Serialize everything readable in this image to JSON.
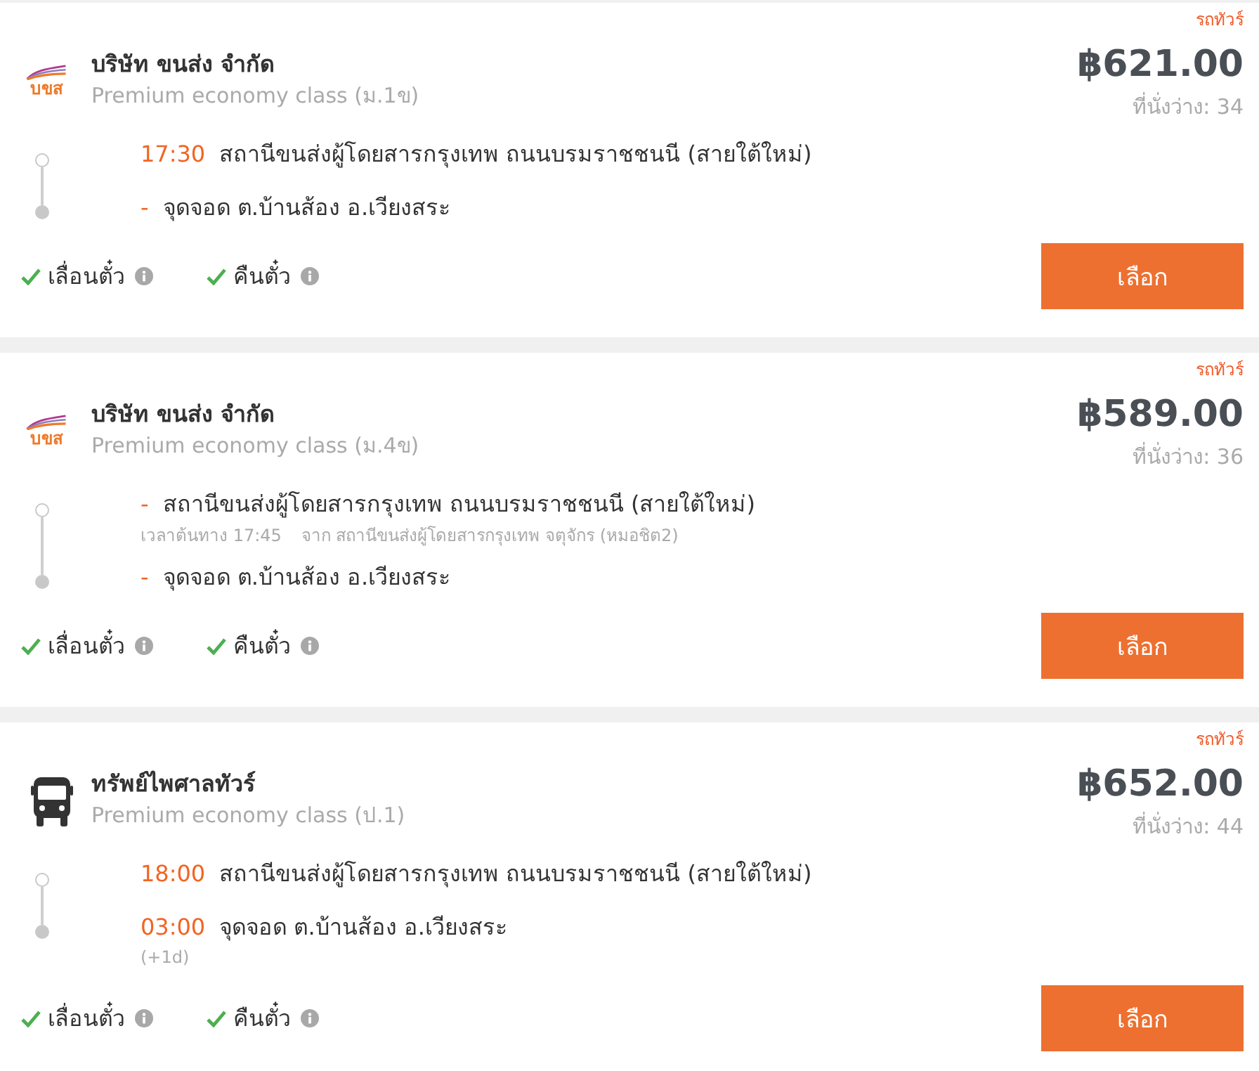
{
  "trips": [
    {
      "tag": "รถทัวร์",
      "logo": {
        "kind": "emblem",
        "text": "บขส"
      },
      "operator": "บริษัท ขนส่ง จำกัด",
      "class": "Premium economy class (ม.1ข)",
      "price": "฿621.00",
      "seats": "ที่นั่งว่าง: 34",
      "stops": [
        {
          "time": "17:30",
          "place": "สถานีขนส่งผู้โดยสารกรุงเทพ ถนนบรมราชชนนี (สายใต้ใหม่)"
        },
        {
          "time": "-",
          "place": "จุดจอด ต.บ้านส้อง อ.เวียงสระ"
        }
      ],
      "features": [
        {
          "label": "เลื่อนตั๋ว",
          "checked": true
        },
        {
          "label": "คืนตั๋ว",
          "checked": true
        }
      ],
      "button": "เลือก"
    },
    {
      "tag": "รถทัวร์",
      "logo": {
        "kind": "emblem",
        "text": "บขส"
      },
      "operator": "บริษัท ขนส่ง จำกัด",
      "class": "Premium economy class (ม.4ข)",
      "price": "฿589.00",
      "seats": "ที่นั่งว่าง: 36",
      "stops": [
        {
          "time": "-",
          "place": "สถานีขนส่งผู้โดยสารกรุงเทพ ถนนบรมราชชนนี (สายใต้ใหม่)",
          "note": [
            "เวลาต้นทาง 17:45",
            "จาก สถานีขนส่งผู้โดยสารกรุงเทพ จตุจักร (หมอชิต2)"
          ]
        },
        {
          "time": "-",
          "place": "จุดจอด ต.บ้านส้อง อ.เวียงสระ"
        }
      ],
      "features": [
        {
          "label": "เลื่อนตั๋ว",
          "checked": true
        },
        {
          "label": "คืนตั๋ว",
          "checked": true
        }
      ],
      "button": "เลือก"
    },
    {
      "tag": "รถทัวร์",
      "logo": {
        "kind": "bus"
      },
      "operator": "ทรัพย์ไพศาลทัวร์",
      "class": "Premium economy class (ป.1)",
      "price": "฿652.00",
      "seats": "ที่นั่งว่าง: 44",
      "stops": [
        {
          "time": "18:00",
          "place": "สถานีขนส่งผู้โดยสารกรุงเทพ ถนนบรมราชชนนี (สายใต้ใหม่)"
        },
        {
          "time": "03:00",
          "place": "จุดจอด ต.บ้านส้อง อ.เวียงสระ",
          "day_offset": "(+1d)"
        }
      ],
      "features": [
        {
          "label": "เลื่อนตั๋ว",
          "checked": true
        },
        {
          "label": "คืนตั๋ว",
          "checked": true
        }
      ],
      "button": "เลือก"
    }
  ]
}
